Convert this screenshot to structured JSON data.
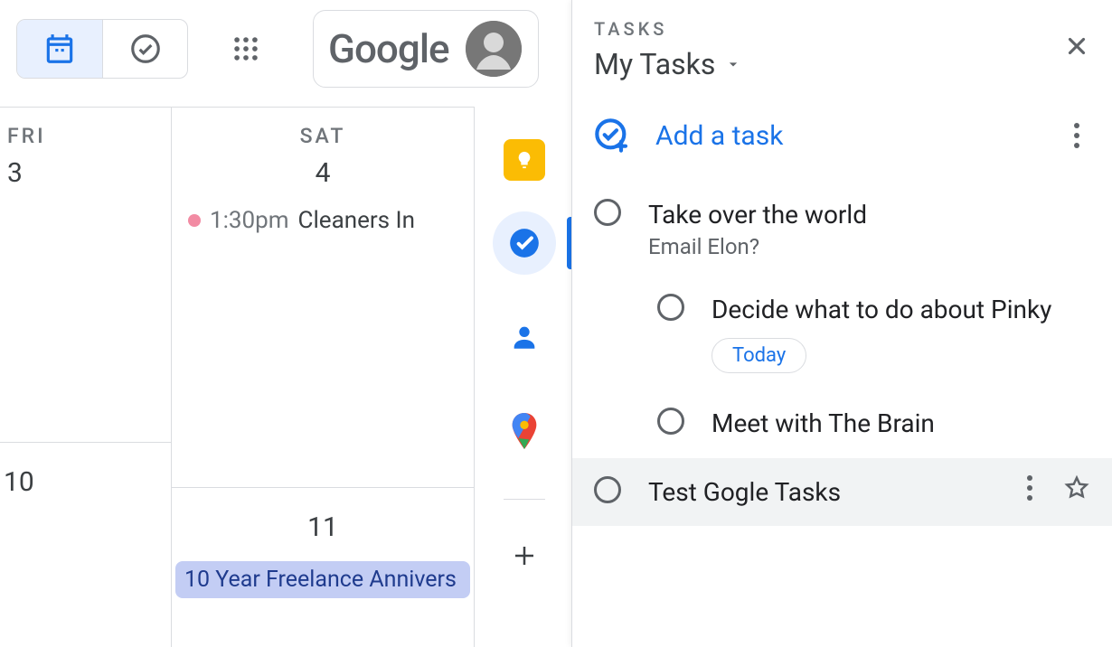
{
  "topbar": {
    "google_label": "Google"
  },
  "calendar": {
    "fri": {
      "label": "FRI",
      "num1": "3",
      "num2": "10"
    },
    "sat": {
      "label": "SAT",
      "num1": "4",
      "num2": "11",
      "event_time": "1:30pm",
      "event_title": "Cleaners In",
      "allday_event": "10 Year Freelance Annivers"
    }
  },
  "tasks": {
    "header_label": "TASKS",
    "list_name": "My Tasks",
    "add_label": "Add a task",
    "items": [
      {
        "title": "Take over the world",
        "note": "Email Elon?"
      },
      {
        "title": "Decide what to do about Pinky",
        "chip": "Today"
      },
      {
        "title": "Meet with The Brain"
      },
      {
        "title": "Test Gogle Tasks"
      }
    ]
  }
}
